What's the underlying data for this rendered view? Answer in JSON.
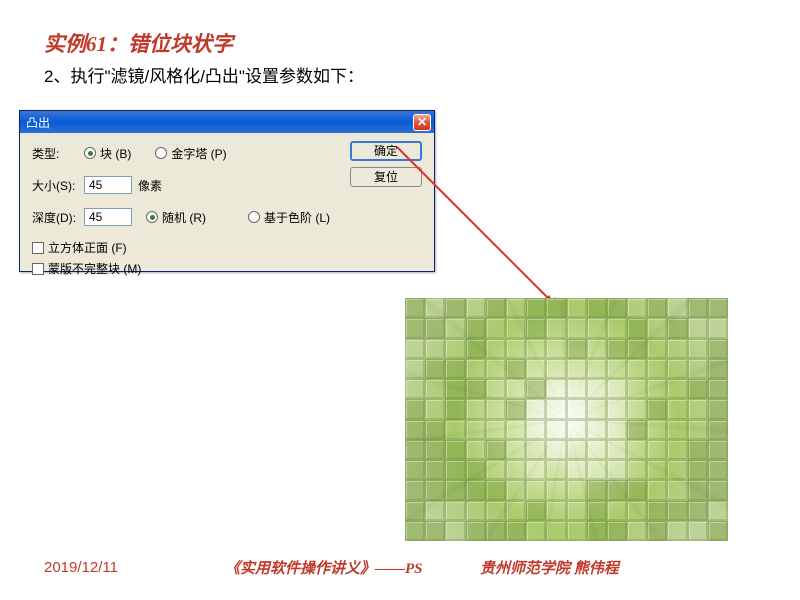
{
  "title": "实例61：错位块状字",
  "step_text": "2、执行\"滤镜/风格化/凸出\"设置参数如下：",
  "dialog": {
    "title": "凸出",
    "type_label": "类型:",
    "type_options": {
      "block": "块 (B)",
      "pyramid": "金字塔 (P)"
    },
    "size_label": "大小(S):",
    "size_value": "45",
    "size_unit": "像素",
    "depth_label": "深度(D):",
    "depth_value": "45",
    "depth_options": {
      "random": "随机 (R)",
      "level": "基于色阶 (L)"
    },
    "checkbox1": "立方体正面 (F)",
    "checkbox2": "蒙版不完整块 (M)",
    "ok": "确定",
    "reset": "复位"
  },
  "date": "2019/12/11",
  "footer_title": "《实用软件操作讲义》——PS",
  "footer_author": "贵州师范学院   熊伟程"
}
